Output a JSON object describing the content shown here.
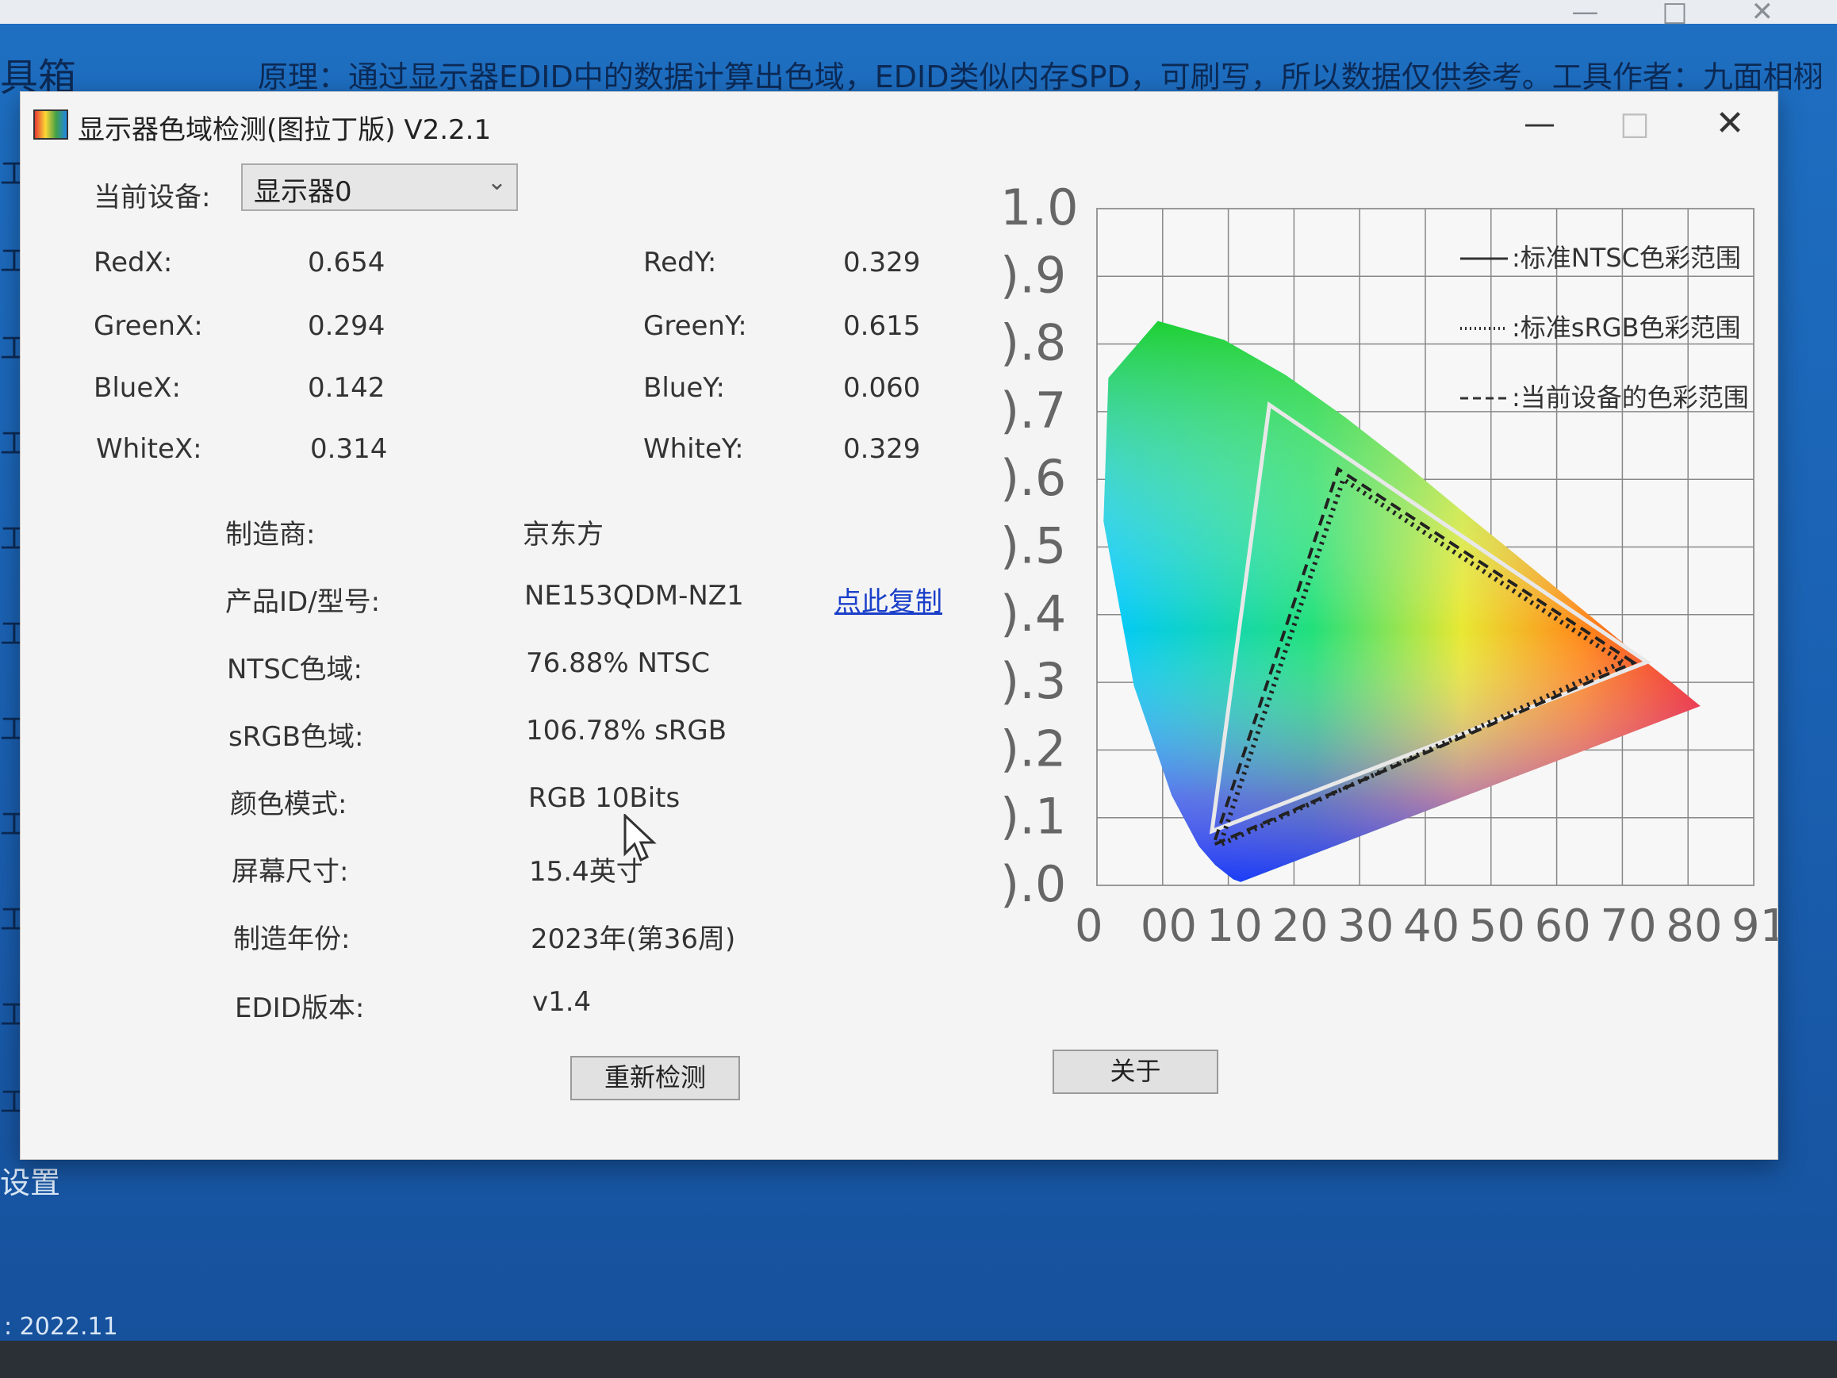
{
  "background": {
    "title_fragment": "具箱",
    "notice": "原理：通过显示器EDID中的数据计算出色域，EDID类似内存SPD，可刷写，所以数据仅供参考。工具作者：九面相栩",
    "sidebar_items": [
      "工",
      "工",
      "工",
      "工",
      "工",
      "工",
      "工",
      "工",
      "工",
      "工",
      "工"
    ],
    "settings_label": "设置",
    "version_text": ": 2022.11"
  },
  "window": {
    "title": "显示器色域检测(图拉丁版) V2.2.1",
    "minimize": "—",
    "maximize": "□",
    "close": "✕"
  },
  "device": {
    "label": "当前设备:",
    "selected": "显示器0",
    "arrow": "⌄"
  },
  "coords": {
    "red_x": {
      "label": "RedX:",
      "value": "0.654"
    },
    "red_y": {
      "label": "RedY:",
      "value": "0.329"
    },
    "green_x": {
      "label": "GreenX:",
      "value": "0.294"
    },
    "green_y": {
      "label": "GreenY:",
      "value": "0.615"
    },
    "blue_x": {
      "label": "BlueX:",
      "value": "0.142"
    },
    "blue_y": {
      "label": "BlueY:",
      "value": "0.060"
    },
    "white_x": {
      "label": "WhiteX:",
      "value": "0.314"
    },
    "white_y": {
      "label": "WhiteY:",
      "value": "0.329"
    }
  },
  "info": {
    "manufacturer": {
      "label": "制造商:",
      "value": "京东方"
    },
    "product_id": {
      "label": "产品ID/型号:",
      "value": "NE153QDM-NZ1",
      "copy_link": "点此复制"
    },
    "ntsc": {
      "label": "NTSC色域:",
      "value": "76.88% NTSC"
    },
    "srgb": {
      "label": "sRGB色域:",
      "value": "106.78% sRGB"
    },
    "color_mode": {
      "label": "颜色模式:",
      "value": "RGB 10Bits"
    },
    "screen_size": {
      "label": "屏幕尺寸:",
      "value": "15.4英寸"
    },
    "year": {
      "label": "制造年份:",
      "value": "2023年(第36周)"
    },
    "edid": {
      "label": "EDID版本:",
      "value": "v1.4"
    }
  },
  "buttons": {
    "redetect": "重新检测",
    "about": "关于"
  },
  "chart_data": {
    "type": "scatter",
    "title": "",
    "xlabel": "",
    "ylabel": "",
    "xlim": [
      0,
      0.8
    ],
    "ylim": [
      0,
      1.0
    ],
    "grid": true,
    "y_ticks": [
      "1.0",
      ").9",
      ").8",
      ").7",
      ").6",
      ").5",
      ").4",
      ").3",
      ").2",
      ").1",
      ").0"
    ],
    "x_ticks": [
      "0",
      "00",
      "10",
      "20",
      "30",
      "40",
      "50",
      "60",
      "70",
      "80",
      "91"
    ],
    "legend_position": "top-right",
    "legend": [
      {
        "label": "标准NTSC色彩范围",
        "style": "solid"
      },
      {
        "label": "标准sRGB色彩范围",
        "style": "dotted"
      },
      {
        "label": "当前设备的色彩范围",
        "style": "dashed"
      }
    ],
    "series": [
      {
        "name": "标准NTSC色彩范围",
        "points": [
          [
            0.67,
            0.33
          ],
          [
            0.21,
            0.71
          ],
          [
            0.14,
            0.08
          ]
        ]
      },
      {
        "name": "标准sRGB色彩范围",
        "points": [
          [
            0.64,
            0.33
          ],
          [
            0.3,
            0.6
          ],
          [
            0.15,
            0.06
          ]
        ]
      },
      {
        "name": "当前设备的色彩范围",
        "points": [
          [
            0.654,
            0.329
          ],
          [
            0.294,
            0.615
          ],
          [
            0.142,
            0.06
          ]
        ]
      }
    ],
    "spectral_locus": [
      [
        0.175,
        0.005
      ],
      [
        0.166,
        0.009
      ],
      [
        0.144,
        0.03
      ],
      [
        0.124,
        0.058
      ],
      [
        0.091,
        0.133
      ],
      [
        0.045,
        0.295
      ],
      [
        0.008,
        0.538
      ],
      [
        0.014,
        0.75
      ],
      [
        0.074,
        0.834
      ],
      [
        0.155,
        0.806
      ],
      [
        0.23,
        0.754
      ],
      [
        0.302,
        0.692
      ],
      [
        0.374,
        0.624
      ],
      [
        0.444,
        0.554
      ],
      [
        0.512,
        0.487
      ],
      [
        0.575,
        0.424
      ],
      [
        0.627,
        0.372
      ],
      [
        0.665,
        0.334
      ],
      [
        0.701,
        0.299
      ],
      [
        0.735,
        0.265
      ]
    ],
    "colors": {
      "ntsc_line": "#e8e8e8",
      "srgb_line": "#222222",
      "device_line": "#222222",
      "grid": "#888888"
    }
  }
}
